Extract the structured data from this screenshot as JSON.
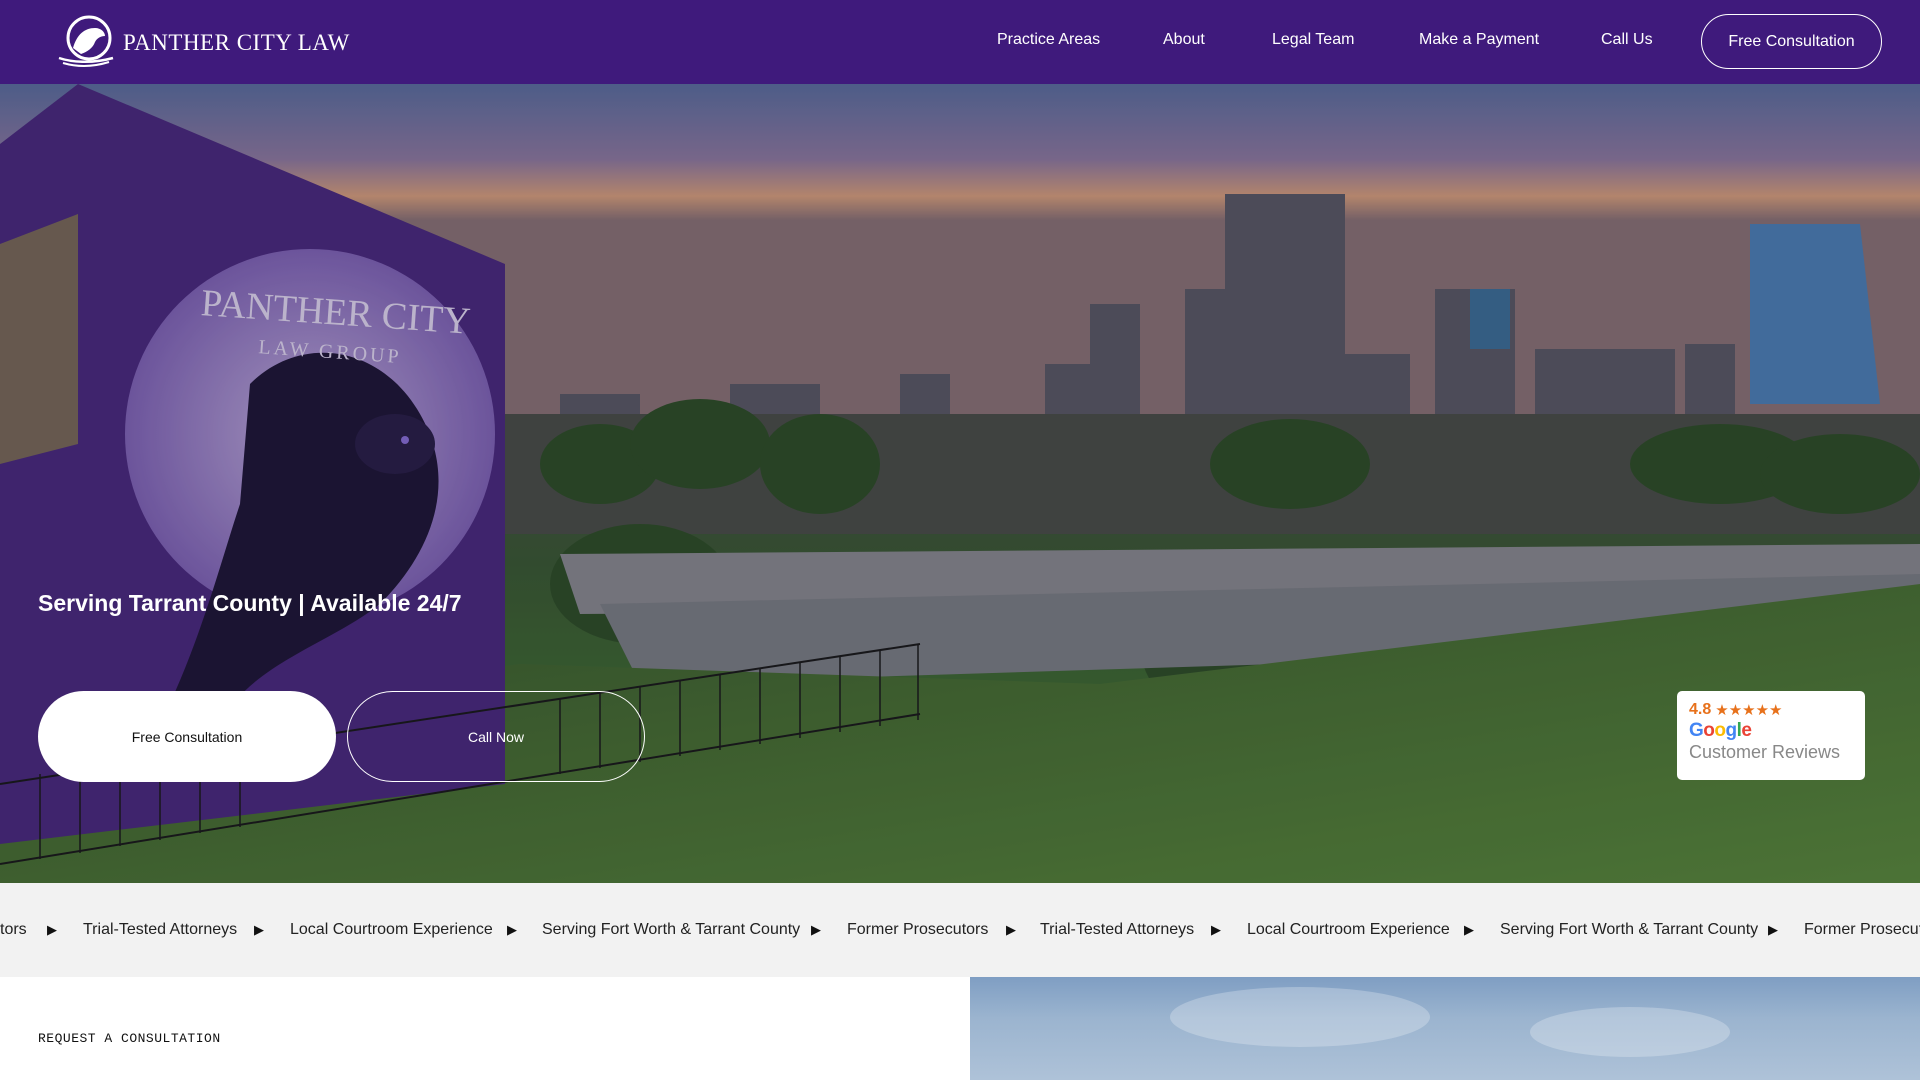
{
  "brand": {
    "name": "PANTHER CITY LAW",
    "logo_icon": "panther-shield-icon"
  },
  "nav": {
    "links": [
      "Practice Areas",
      "About",
      "Legal Team",
      "Make a Payment",
      "Call Us"
    ],
    "cta": "Free Consultation"
  },
  "hero": {
    "mural_title": "PANTHER CITY",
    "mural_subtitle": "LAW GROUP",
    "tagline": "Serving Tarrant County | Available 24/7",
    "primary_button": "Free Consultation",
    "secondary_button": "Call Now"
  },
  "review": {
    "rating": "4.8",
    "stars": "★★★★★",
    "provider": "Google",
    "label": "Customer Reviews",
    "star_color": "#e7711b"
  },
  "ticker": {
    "items": [
      "tors",
      "Trial-Tested Attorneys",
      "Local Courtroom Experience",
      "Serving Fort Worth & Tarrant County",
      "Former Prosecutors",
      "Trial-Tested Attorneys",
      "Local Courtroom Experience",
      "Serving Fort Worth & Tarrant County",
      "Former Prosecut"
    ],
    "separator": "▶"
  },
  "section": {
    "label": "REQUEST A CONSULTATION"
  },
  "colors": {
    "nav_bg": "#3f1a7c",
    "ticker_bg": "#f2f2f2"
  }
}
